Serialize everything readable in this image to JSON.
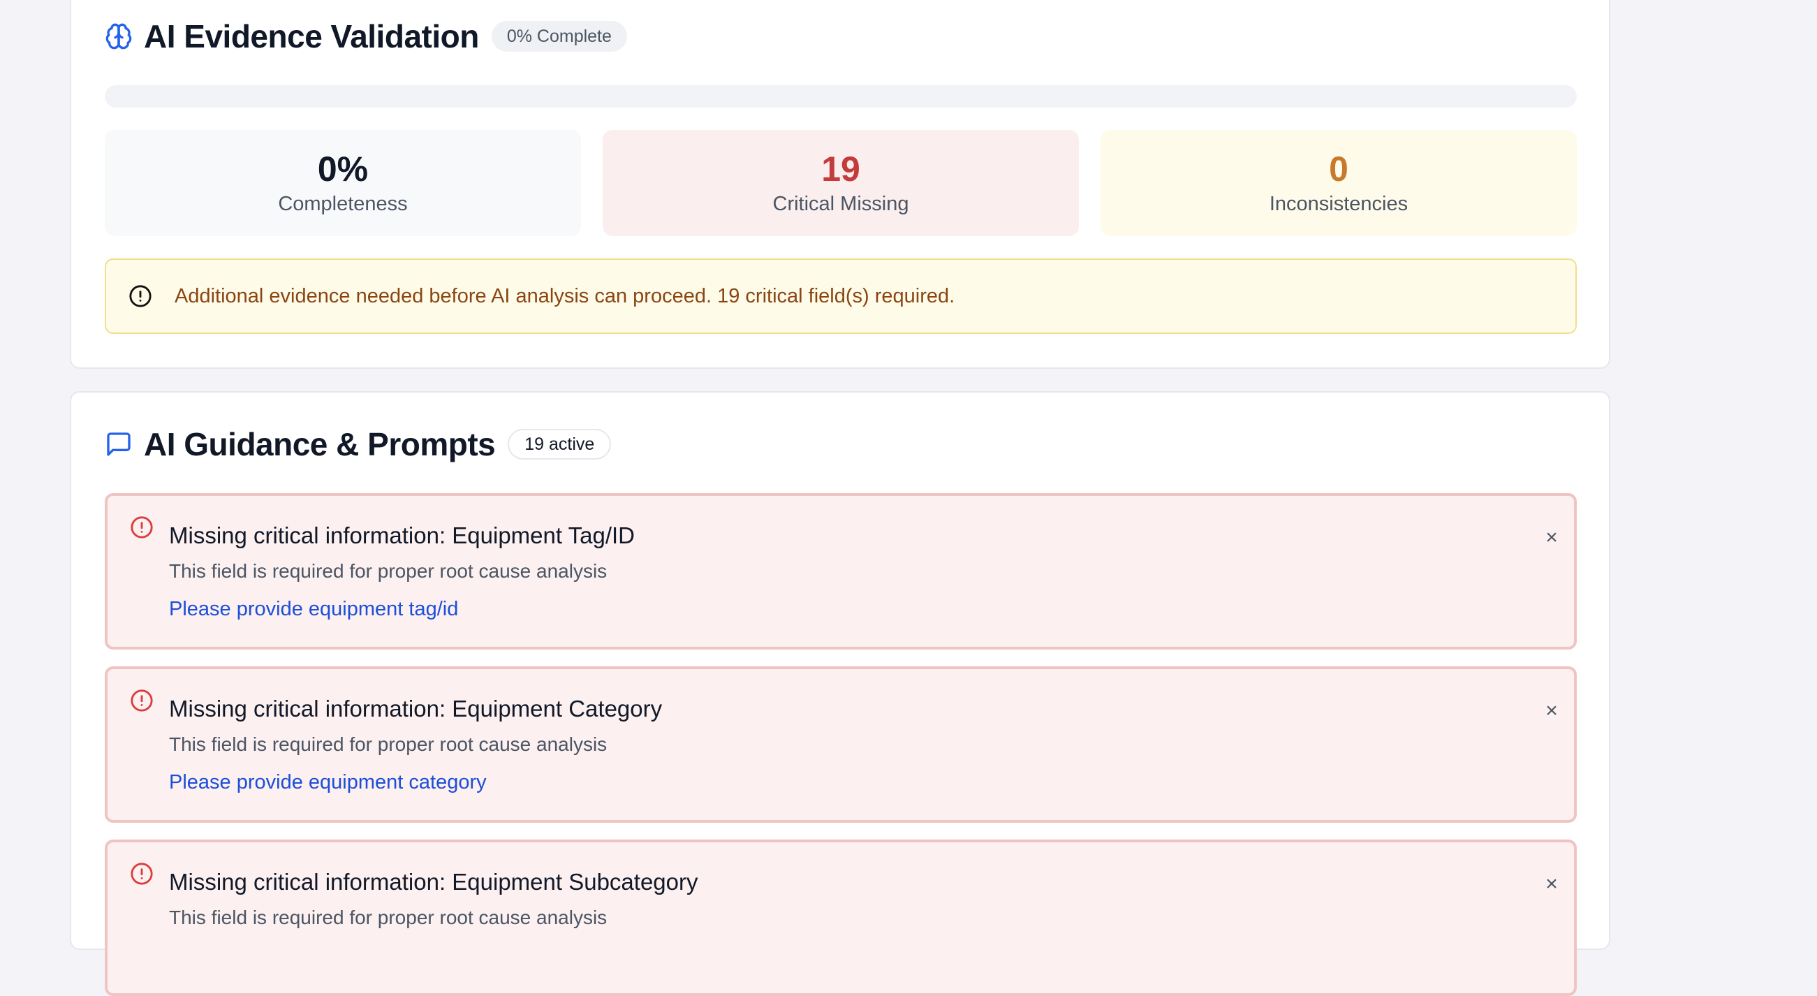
{
  "validation": {
    "title": "AI Evidence Validation",
    "badge": "0% Complete",
    "progress_percent": 0,
    "stats": {
      "completeness": {
        "value": "0%",
        "label": "Completeness"
      },
      "critical_missing": {
        "value": "19",
        "label": "Critical Missing"
      },
      "inconsistencies": {
        "value": "0",
        "label": "Inconsistencies"
      }
    },
    "notice": "Additional evidence needed before AI analysis can proceed. 19 critical field(s) required."
  },
  "guidance": {
    "title": "AI Guidance & Prompts",
    "badge": "19 active",
    "prompts": [
      {
        "title": "Missing critical information: Equipment Tag/ID",
        "description": "This field is required for proper root cause analysis",
        "action": "Please provide equipment tag/id",
        "close": "×"
      },
      {
        "title": "Missing critical information: Equipment Category",
        "description": "This field is required for proper root cause analysis",
        "action": "Please provide equipment category",
        "close": "×"
      },
      {
        "title": "Missing critical information: Equipment Subcategory",
        "description": "This field is required for proper root cause analysis",
        "action": "",
        "close": "×"
      }
    ]
  },
  "colors": {
    "accent_blue": "#2563eb",
    "critical_red": "#c43b3b",
    "warning_orange": "#c87a2c",
    "notice_brown": "#8a4513"
  },
  "icons": {
    "validation_header": "brain-icon",
    "guidance_header": "message-square-icon",
    "notice": "alert-circle-icon",
    "prompt": "alert-circle-icon",
    "close": "close-icon"
  }
}
